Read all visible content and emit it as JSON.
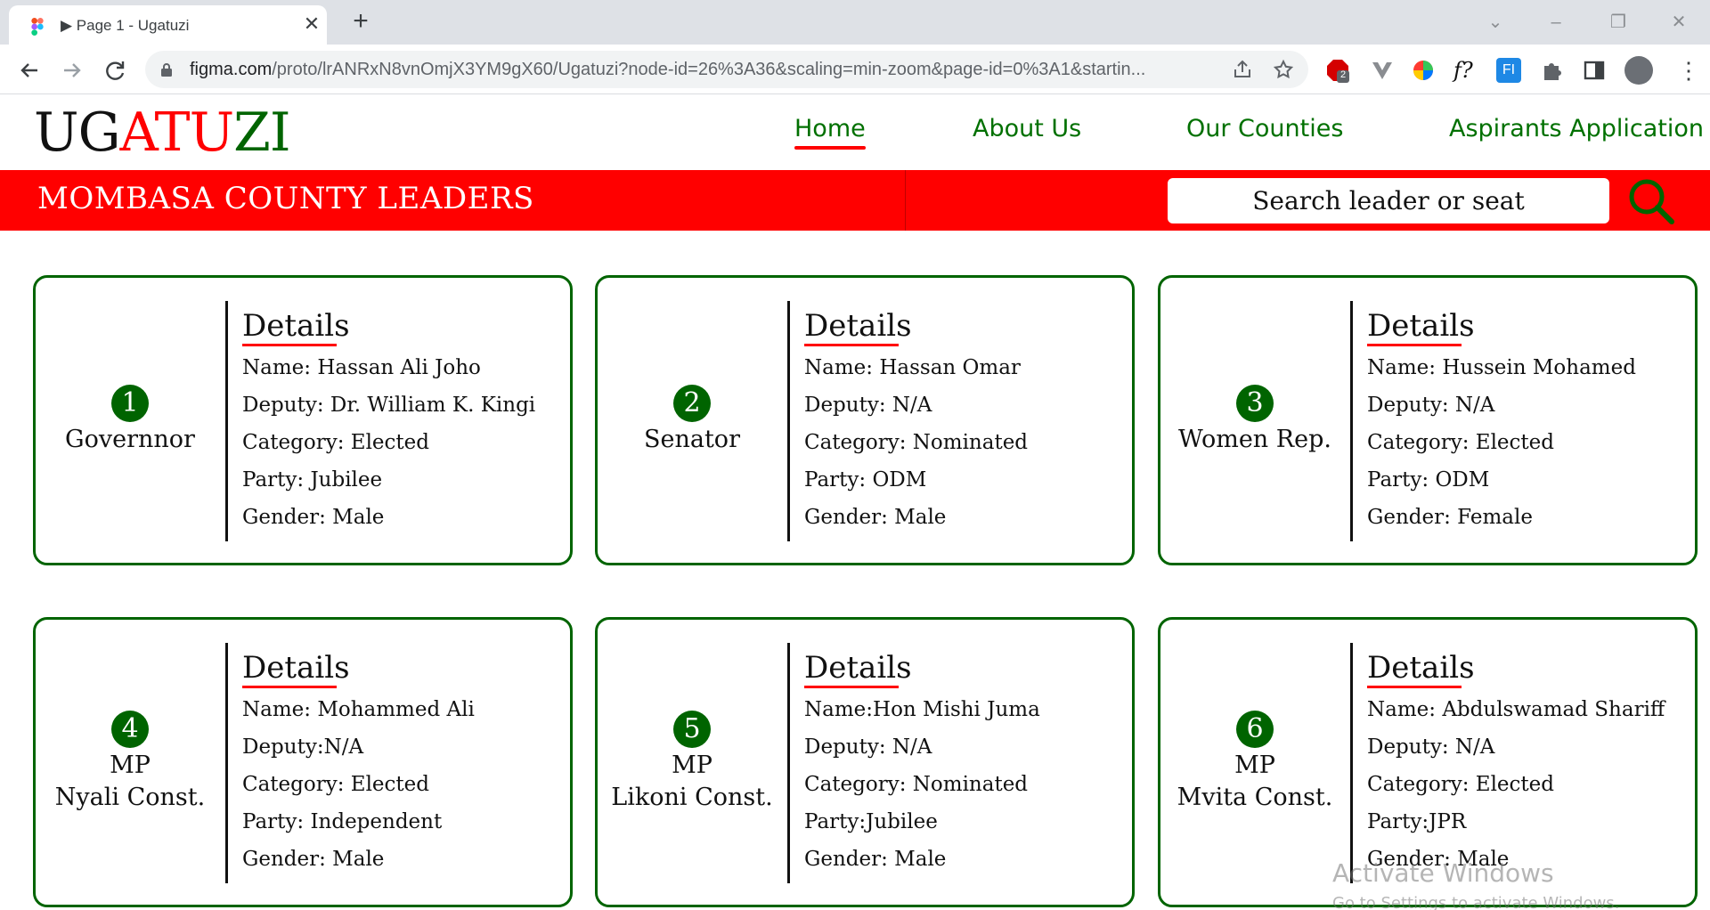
{
  "browser": {
    "tab_title": "Page 1 - Ugatuzi",
    "new_tab_label": "+",
    "url_host": "figma.com",
    "url_path": "/proto/lrANRxN8vnOmjX3YM9gX60/Ugatuzi?node-id=26%3A36&scaling=min-zoom&page-id=0%3A1&startin...",
    "extension_badge": "2"
  },
  "site": {
    "logo_part1": "UG",
    "logo_part2": "ATU",
    "logo_part3": "ZI",
    "nav": {
      "home": "Home",
      "about": "About Us",
      "counties": "Our Counties",
      "aspirants": "Aspirants Application"
    },
    "banner_title": "MOMBASA COUNTY LEADERS",
    "search_placeholder": "Search leader or seat"
  },
  "cards": [
    {
      "number": "1",
      "role_line1": "Governnor",
      "role_line2": "",
      "details_title": "Details",
      "name": "Name: Hassan Ali Joho",
      "deputy": "Deputy: Dr. William K. Kingi",
      "category": "Category: Elected",
      "party": "Party: Jubilee",
      "gender": "Gender: Male"
    },
    {
      "number": "2",
      "role_line1": "Senator",
      "role_line2": "",
      "details_title": "Details",
      "name": "Name: Hassan Omar",
      "deputy": "Deputy: N/A",
      "category": "Category: Nominated",
      "party": "Party: ODM",
      "gender": "Gender: Male"
    },
    {
      "number": "3",
      "role_line1": "Women Rep.",
      "role_line2": "",
      "details_title": "Details",
      "name": "Name: Hussein Mohamed",
      "deputy": "Deputy: N/A",
      "category": "Category: Elected",
      "party": "Party: ODM",
      "gender": "Gender: Female"
    },
    {
      "number": "4",
      "role_line1": "MP",
      "role_line2": "Nyali Const.",
      "details_title": "Details",
      "name": "Name: Mohammed Ali",
      "deputy": "Deputy:N/A",
      "category": "Category: Elected",
      "party": "Party: Independent",
      "gender": "Gender: Male"
    },
    {
      "number": "5",
      "role_line1": "MP",
      "role_line2": "Likoni Const.",
      "details_title": "Details",
      "name": "Name:Hon Mishi Juma",
      "deputy": "Deputy: N/A",
      "category": "Category: Nominated",
      "party": "Party:Jubilee",
      "gender": "Gender: Male"
    },
    {
      "number": "6",
      "role_line1": "MP",
      "role_line2": "Mvita Const.",
      "details_title": "Details",
      "name": "Name: Abdulswamad Shariff",
      "deputy": "Deputy: N/A",
      "category": "Category: Elected",
      "party": "Party:JPR",
      "gender": "Gender: Male"
    }
  ],
  "watermark": {
    "line1": "Activate Windows",
    "line2": "Go to Settings to activate Windows."
  },
  "colors": {
    "brand_red": "#ff0000",
    "brand_green": "#006400",
    "nav_green": "#007000"
  },
  "icons": [
    "figma-favicon",
    "play-icon",
    "close-icon",
    "plus-icon",
    "back-arrow-icon",
    "forward-arrow-icon",
    "reload-icon",
    "lock-icon",
    "share-icon",
    "star-icon",
    "extension-icons",
    "puzzle-icon",
    "sidepanel-icon",
    "profile-avatar",
    "kebab-menu-icon",
    "search-icon"
  ]
}
